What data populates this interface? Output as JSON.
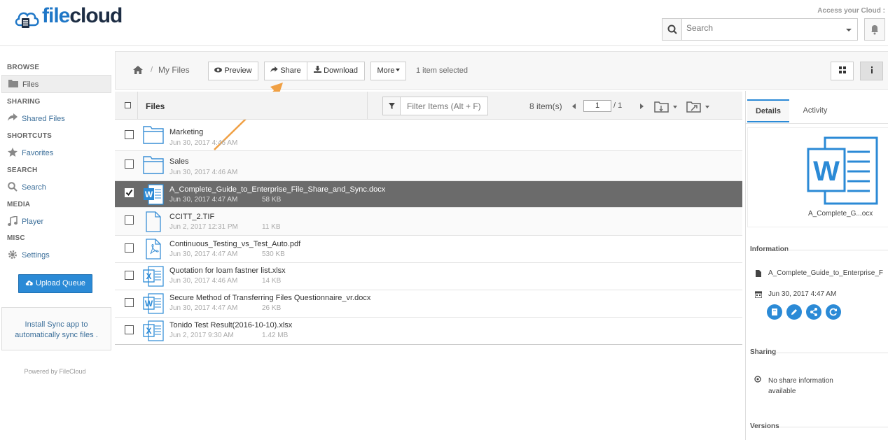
{
  "header": {
    "logo_file": "file",
    "logo_cloud": "cloud",
    "access_text": "Access your Cloud :",
    "search_placeholder": "Search"
  },
  "sidebar": {
    "sections": {
      "browse": "BROWSE",
      "sharing": "SHARING",
      "shortcuts": "SHORTCUTS",
      "search": "SEARCH",
      "media": "MEDIA",
      "misc": "MISC"
    },
    "items": {
      "files": "Files",
      "shared_files": "Shared Files",
      "favorites": "Favorites",
      "search": "Search",
      "player": "Player",
      "settings": "Settings"
    },
    "upload_label": "Upload Queue",
    "sync_line1": "Install Sync app to",
    "sync_line2": "automatically sync files .",
    "powered": "Powered by FileCloud"
  },
  "toolbar": {
    "breadcrumb_sep": "/",
    "breadcrumb": "My Files",
    "preview": "Preview",
    "share": "Share",
    "download": "Download",
    "more": "More",
    "selection": "1 item selected"
  },
  "list": {
    "header_label": "Files",
    "filter_placeholder": "Filter Items (Alt + F)",
    "item_count": "8 item(s)",
    "page_value": "1",
    "page_total": "/ 1",
    "rows": [
      {
        "name": "Marketing",
        "date": "Jun 30, 2017 4:46 AM",
        "size": "",
        "type": "folder",
        "selected": false
      },
      {
        "name": "Sales",
        "date": "Jun 30, 2017 4:46 AM",
        "size": "",
        "type": "folder",
        "selected": false
      },
      {
        "name": "A_Complete_Guide_to_Enterprise_File_Share_and_Sync.docx",
        "date": "Jun 30, 2017 4:47 AM",
        "size": "58 KB",
        "type": "word",
        "selected": true
      },
      {
        "name": "CCITT_2.TIF",
        "date": "Jun 2, 2017 12:31 PM",
        "size": "11 KB",
        "type": "file",
        "selected": false
      },
      {
        "name": "Continuous_Testing_vs_Test_Auto.pdf",
        "date": "Jun 30, 2017 4:47 AM",
        "size": "530 KB",
        "type": "pdf",
        "selected": false
      },
      {
        "name": "Quotation for loam fastner list.xlsx",
        "date": "Jun 30, 2017 4:46 AM",
        "size": "14 KB",
        "type": "excel",
        "selected": false
      },
      {
        "name": "Secure Method of Transferring Files Questionnaire_vr.docx",
        "date": "Jun 30, 2017 4:47 AM",
        "size": "26 KB",
        "type": "word",
        "selected": false
      },
      {
        "name": "Tonido Test Result(2016-10-10).xlsx",
        "date": "Jun 2, 2017 9:30 AM",
        "size": "1.42 MB",
        "type": "excel",
        "selected": false
      }
    ]
  },
  "details": {
    "tab_details": "Details",
    "tab_activity": "Activity",
    "preview_caption": "A_Complete_G...ocx",
    "information_title": "Information",
    "info_filename": "A_Complete_Guide_to_Enterprise_F",
    "info_date": "Jun 30, 2017 4:47 AM",
    "sharing_title": "Sharing",
    "no_share_line1": "No share information",
    "no_share_line2": "available",
    "versions_title": "Versions"
  },
  "colors": {
    "accent": "#2b8ad6",
    "selected_row": "#6b6b6b",
    "arrow": "#f0a044",
    "word_icon": "#2b8ad6"
  }
}
